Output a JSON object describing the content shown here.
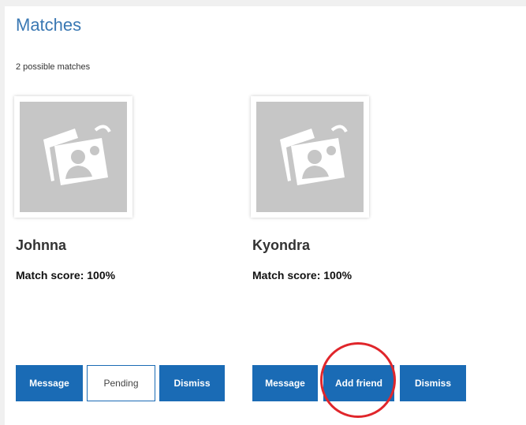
{
  "page": {
    "title": "Matches",
    "subtitle": "2 possible matches"
  },
  "matches": [
    {
      "name": "Johnna",
      "score_text": "Match score: 100%",
      "score_percent": 100,
      "buttons": {
        "message": "Message",
        "friend_status": "Pending",
        "dismiss": "Dismiss"
      }
    },
    {
      "name": "Kyondra",
      "score_text": "Match score: 100%",
      "score_percent": 100,
      "buttons": {
        "message": "Message",
        "friend_status": "Add friend",
        "dismiss": "Dismiss"
      }
    }
  ],
  "icons": {
    "avatar_placeholder": "photo-placeholder-icon"
  },
  "colors": {
    "title": "#3a78b3",
    "primary_button": "#1a6bb5",
    "annotation": "#e0262b",
    "avatar_bg": "#c6c6c6"
  }
}
